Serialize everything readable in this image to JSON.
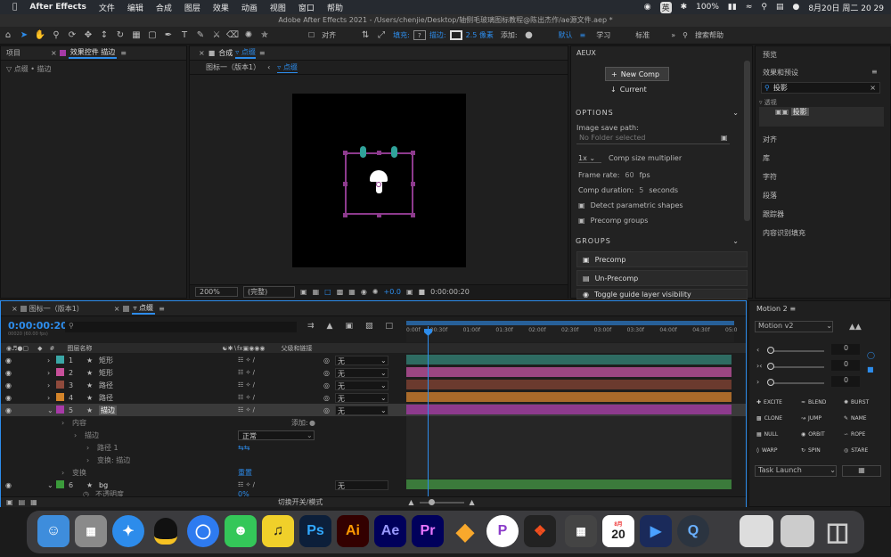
{
  "menubar": {
    "app": "After Effects",
    "items": [
      "文件",
      "编辑",
      "合成",
      "图层",
      "效果",
      "动画",
      "视图",
      "窗口",
      "帮助"
    ],
    "status_badge": "英",
    "battery": "100%",
    "datetime": "8月20日 周二 20 29"
  },
  "title": "Adobe After Effects 2021 - /Users/chenjie/Desktop/轴侧毛玻璃图标教程@陈出杰作/ae源文件.aep *",
  "toolbar": {
    "align": "对齐",
    "fill_label": "填充:",
    "stroke_label": "描边:",
    "stroke_value": "2.5 像素",
    "add_label": "添加:",
    "workspaces": [
      "默认",
      "学习",
      "标准"
    ],
    "help_search": "搜索帮助"
  },
  "left_panel": {
    "tab1": "项目",
    "tab2": "效果控件 描边",
    "breadcrumb": "▽ 点缀 • 描边"
  },
  "comp_panel": {
    "tab_prefix": "合成",
    "tab_name": "▿ 点缀",
    "crumb1": "图标一（版本1）",
    "crumb2": "▿ 点缀",
    "zoom": "200%",
    "quality": "(完整)",
    "exposure": "+0.0",
    "time": "0:00:00:20"
  },
  "aeux": {
    "title": "AEUX",
    "new_comp": "New Comp",
    "current": "Current",
    "options": "OPTIONS",
    "save_path_label": "Image save path:",
    "save_path_placeholder": "No Folder selected",
    "size_mult": "1x",
    "size_mult_label": "Comp size multiplier",
    "frame_rate_label": "Frame rate:",
    "frame_rate_value": "60",
    "frame_rate_unit": "fps",
    "duration_label": "Comp duration:",
    "duration_value": "5",
    "duration_unit": "seconds",
    "detect": "Detect parametric shapes",
    "precomp_groups": "Precomp groups",
    "groups": "GROUPS",
    "precomp": "Precomp",
    "unprecomp": "Un-Precomp",
    "toggle_guide": "Toggle guide layer visibility"
  },
  "right_panel": {
    "preview": "预览",
    "effects": "效果和预设",
    "search": "投影",
    "tree_parent": "透视",
    "tree_item": "投影",
    "links": [
      "对齐",
      "库",
      "字符",
      "段落",
      "跟踪器",
      "内容识别填充"
    ]
  },
  "timeline": {
    "tab1": "图标一（版本1）",
    "tab2": "▿ 点缀",
    "timecode": "0:00:00:20",
    "fps_hint": "00020 (60.00 fps)",
    "col_num": "#",
    "col_name": "图层名称",
    "col_parent": "父级和链接",
    "ruler": [
      "0:00f",
      "00:30f",
      "01:00f",
      "01:30f",
      "02:00f",
      "02:30f",
      "03:00f",
      "03:30f",
      "04:00f",
      "04:30f",
      "05:0"
    ],
    "layers": [
      {
        "num": "1",
        "name": "矩形",
        "parent": "无",
        "color": "#3aa7a6"
      },
      {
        "num": "2",
        "name": "矩形",
        "parent": "无",
        "color": "#c7509a"
      },
      {
        "num": "3",
        "name": "路径",
        "parent": "无",
        "color": "#8f4a3c"
      },
      {
        "num": "4",
        "name": "路径",
        "parent": "无",
        "color": "#d3842a"
      },
      {
        "num": "5",
        "name": "描边",
        "parent": "无",
        "color": "#a83aa8"
      }
    ],
    "sub": {
      "content": "内容",
      "add": "添加:",
      "stroke": "描边",
      "mode": "正常",
      "path1": "路径 1",
      "transform_stroke": "变换: 描边",
      "transform": "变换",
      "reset": "重置",
      "bg_num": "6",
      "bg_name": "bg",
      "bg_parent": "无",
      "opacity": "不透明度",
      "opacity_val": "0%"
    },
    "footer": "切换开关/模式",
    "bar_colors": [
      "#2e6b62",
      "#9b4682",
      "#6b3a2e",
      "#a96a2a",
      "#8d3a8d",
      "#3b7a3b"
    ]
  },
  "motion": {
    "title": "Motion 2",
    "version": "Motion v2",
    "val1": "0",
    "val2": "0",
    "val3": "0",
    "buttons": [
      "EXCITE",
      "BLEND",
      "BURST",
      "CLONE",
      "JUMP",
      "NAME",
      "NULL",
      "ORBIT",
      "ROPE",
      "WARP",
      "SPIN",
      "STARE"
    ],
    "task": "Task Launch"
  },
  "dock": {
    "ps": "Ps",
    "ai": "Ai",
    "ae": "Ae",
    "pr": "Pr",
    "cal_month": "8月",
    "cal_day": "20"
  },
  "colors": {
    "accent": "#2d8ceb",
    "selection": "#a63aa6",
    "handle": "#30a39b"
  }
}
